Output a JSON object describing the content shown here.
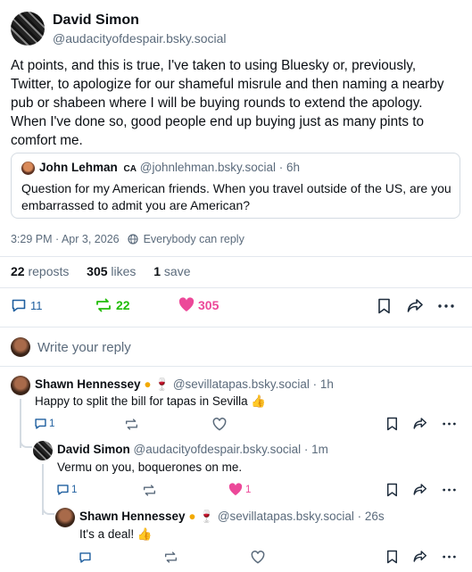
{
  "post": {
    "author_name": "David Simon",
    "author_handle": "@audacityofdespair.bsky.social",
    "text": "At points, and this is true, I've taken to using Bluesky or, previously, Twitter, to apologize for our shameful misrule and then naming a nearby pub or shabeen where I will be buying rounds to extend the apology. When I've done so, good people end up buying just as many pints to comfort me.",
    "quote": {
      "author_name": "John Lehman",
      "author_badge": "CA",
      "author_handle": "@johnlehman.bsky.social",
      "age": "· 6h",
      "text": "Question for my American friends. When you travel outside of the US, are you embarrassed to admit you are American?"
    },
    "timestamp": "3:29 PM · Apr 3, 2026",
    "visibility": "Everybody can reply",
    "stats": {
      "reposts_count": "22",
      "reposts_label": "reposts",
      "likes_count": "305",
      "likes_label": "likes",
      "saves_count": "1",
      "saves_label": "save"
    },
    "actions": {
      "replies": "11",
      "reposts": "22",
      "likes": "305"
    }
  },
  "reply_box": {
    "placeholder": "Write your reply"
  },
  "replies": [
    {
      "author_name": "Shawn Hennessey",
      "author_handle": "@sevillatapas.bsky.social",
      "age": "· 1h",
      "text": "Happy to split the bill for tapas in Sevilla 👍",
      "replies": "1",
      "reposts": "",
      "likes": ""
    },
    {
      "author_name": "David Simon",
      "author_handle": "@audacityofdespair.bsky.social",
      "age": "· 1m",
      "text": "Vermu on you, boquerones on me.",
      "replies": "1",
      "reposts": "",
      "likes": "1"
    },
    {
      "author_name": "Shawn Hennessey",
      "author_handle": "@sevillatapas.bsky.social",
      "age": "· 26s",
      "text": "It's a deal! 👍",
      "replies": "",
      "reposts": "",
      "likes": ""
    }
  ],
  "colors": {
    "repost_active": "#20bc07",
    "like_active": "#ec4899",
    "link": "#1083fe",
    "muted": "#5b6b7c"
  }
}
